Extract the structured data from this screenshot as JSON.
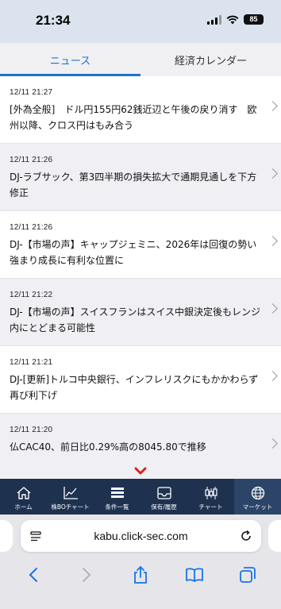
{
  "status": {
    "time": "21:34",
    "battery": "85"
  },
  "tabs": [
    {
      "label": "ニュース",
      "active": true
    },
    {
      "label": "経済カレンダー",
      "active": false
    }
  ],
  "news": [
    {
      "date": "12/11 21:27",
      "title": "[外為全般]　ドル円155円62銭近辺と午後の戻り消す　欧州以降、クロス円はもみ合う"
    },
    {
      "date": "12/11 21:26",
      "title": "DJ-ラブサック、第3四半期の損失拡大で通期見通しを下方修正"
    },
    {
      "date": "12/11 21:26",
      "title": "DJ-【市場の声】キャップジェミニ、2026年は回復の勢い強まり成長に有利な位置に"
    },
    {
      "date": "12/11 21:22",
      "title": "DJ-【市場の声】スイスフランはスイス中銀決定後もレンジ内にとどまる可能性"
    },
    {
      "date": "12/11 21:21",
      "title": "DJ-[更新]トルコ中央銀行、インフレリスクにもかかわらず再び利下げ"
    },
    {
      "date": "12/11 21:20",
      "title": "仏CAC40、前日比0.29%高の8045.80で推移"
    }
  ],
  "bottom_nav": [
    {
      "label": "ホーム",
      "icon": "home-icon"
    },
    {
      "label": "株BOチャート",
      "icon": "chart-line-icon"
    },
    {
      "label": "条件一覧",
      "icon": "list-icon"
    },
    {
      "label": "保有/履歴",
      "icon": "tray-icon"
    },
    {
      "label": "チャート",
      "icon": "candlestick-icon"
    },
    {
      "label": "マーケット",
      "icon": "globe-icon",
      "active": true
    }
  ],
  "browser": {
    "url": "kabu.click-sec.com"
  },
  "colors": {
    "accent": "#1a73c8",
    "nav_bg": "#1e3250",
    "alert": "#d9231d"
  }
}
